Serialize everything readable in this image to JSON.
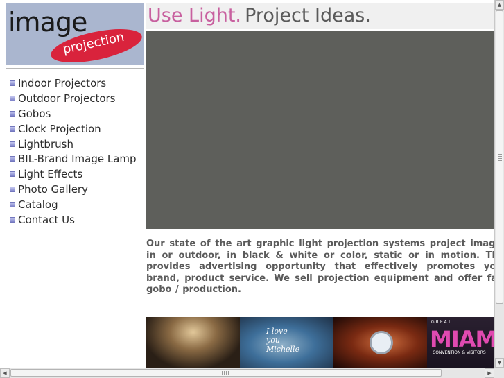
{
  "logo": {
    "word": "image",
    "sub": "projection"
  },
  "nav": {
    "items": [
      {
        "label": "Indoor Projectors"
      },
      {
        "label": "Outdoor Projectors"
      },
      {
        "label": "Gobos"
      },
      {
        "label": "Clock Projection"
      },
      {
        "label": "Lightbrush"
      },
      {
        "label": "BIL-Brand Image Lamp"
      },
      {
        "label": "Light Effects"
      },
      {
        "label": "Photo Gallery"
      },
      {
        "label": "Catalog"
      },
      {
        "label": "Contact Us"
      }
    ],
    "bullet_icon": "square-bullet-icon"
  },
  "headline": {
    "accent": "Use Light.",
    "rest": "Project Ideas."
  },
  "intro": {
    "text": "Our state of the art graphic light projection systems project images in or outdoor, in black & white or color, static or in motion. This provides advertising opportunity that effectively promotes your brand, product service. We sell projection equipment and offer fast gobo / production."
  },
  "thumbnails": {
    "thumb2_caption_line1": "I love",
    "thumb2_caption_line2": "you",
    "thumb2_caption_line3": "Michelle",
    "thumb4_top": "GREAT",
    "thumb4_big": "MIAM",
    "thumb4_tag": "CONVENTION & VISITORS"
  },
  "colors": {
    "accent_pink": "#c8609f",
    "headline_gray": "#5a5a5a",
    "hero_gray": "#5e5f5b",
    "logo_bg": "#aab6cf",
    "logo_red": "#d9233c"
  }
}
